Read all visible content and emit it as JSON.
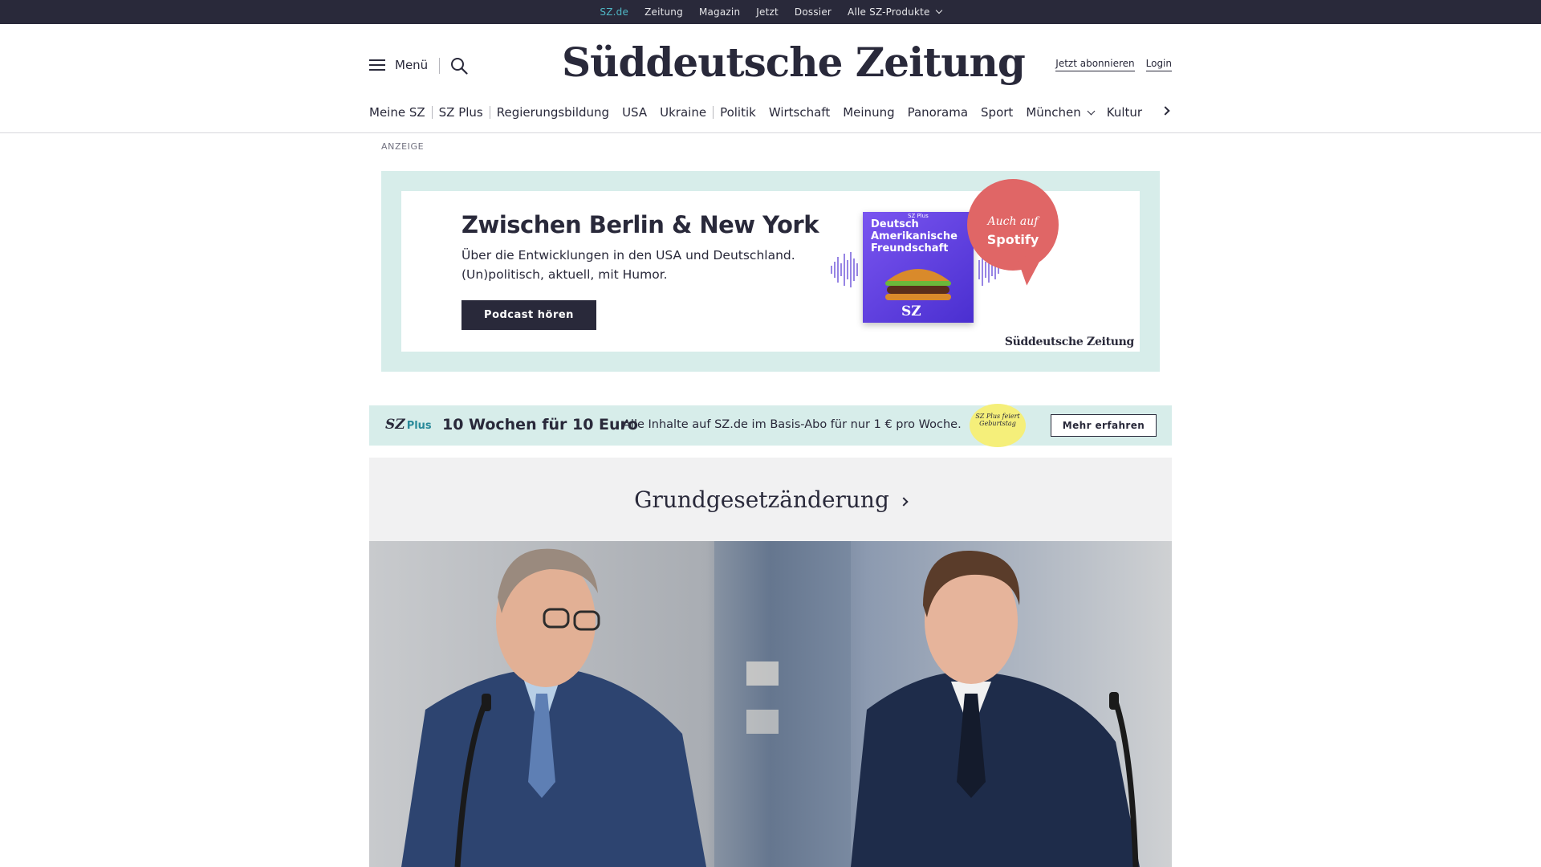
{
  "topbar": {
    "items": [
      "SZ.de",
      "Zeitung",
      "Magazin",
      "Jetzt",
      "Dossier",
      "Alle SZ-Produkte"
    ]
  },
  "header": {
    "menu_label": "Menü",
    "logo": "Süddeutsche Zeitung",
    "subscribe": "Jetzt abonnieren",
    "login": "Login"
  },
  "ressorts": [
    "Meine SZ",
    "SZ Plus",
    "Regierungsbildung",
    "USA",
    "Ukraine",
    "Politik",
    "Wirtschaft",
    "Meinung",
    "Panorama",
    "Sport",
    "München",
    "Kultur"
  ],
  "ad": {
    "label": "ANZEIGE",
    "title": "Zwischen Berlin & New York",
    "text": "Über die Entwicklungen in den USA und Deutschland. (Un)politisch, aktuell, mit Humor.",
    "button": "Podcast hören",
    "cover_badge": "SZ Plus",
    "cover_title": "Deutsch Amerikanische Freundschaft",
    "cover_logo": "SZ",
    "bubble_line1": "Auch auf",
    "bubble_line2": "Spotify",
    "footer_logo": "Süddeutsche Zeitung"
  },
  "promo": {
    "logo": "SZ",
    "logo_suffix": "Plus",
    "headline": "10 Wochen für 10 Euro",
    "text": "Alle Inhalte auf SZ.de im Basis-Abo für nur 1 € pro Woche.",
    "badge": "SZ Plus feiert Geburtstag",
    "button": "Mehr erfahren"
  },
  "topic": {
    "title": "Grundgesetzänderung"
  },
  "colors": {
    "dark": "#29293a",
    "accent_teal": "#4fb8c6",
    "mint": "#d7edea",
    "coral": "#e06666"
  }
}
